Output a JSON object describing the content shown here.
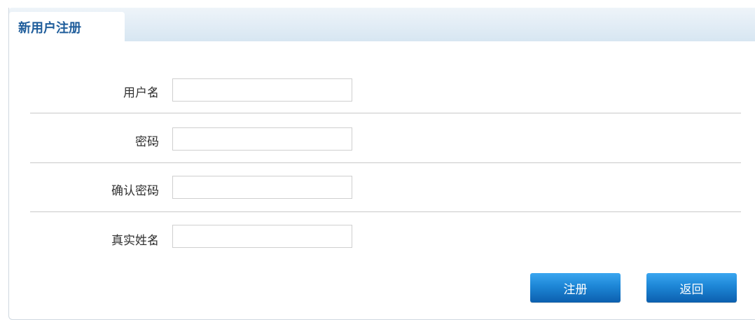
{
  "panel": {
    "title": "新用户注册"
  },
  "form": {
    "fields": [
      {
        "label": "用户名",
        "colon": "：",
        "value": "",
        "placeholder": ""
      },
      {
        "label": "密码",
        "colon": "：",
        "value": "",
        "placeholder": ""
      },
      {
        "label": "确认密码",
        "colon": "：",
        "value": "",
        "placeholder": ""
      },
      {
        "label": "真实姓名",
        "colon": "：",
        "value": "",
        "placeholder": ""
      }
    ]
  },
  "actions": {
    "register_label": "注册",
    "back_label": "返回"
  },
  "colors": {
    "title_text": "#1f5d9b",
    "button_top": "#3aa6f0",
    "button_bottom": "#0c5fae",
    "header_gradient_start": "#eef4f9",
    "header_gradient_end": "#d7e6f2"
  }
}
